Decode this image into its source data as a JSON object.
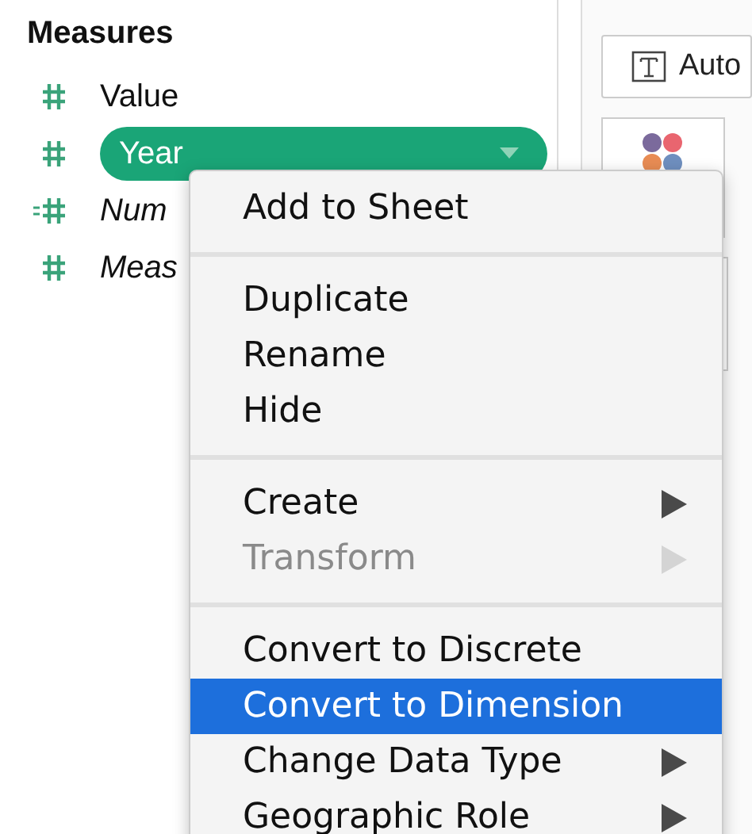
{
  "measures": {
    "title": "Measures",
    "fields": [
      {
        "name": "Value",
        "kind": "plain",
        "italic": false,
        "selected": false
      },
      {
        "name": "Year",
        "kind": "plain",
        "italic": false,
        "selected": true
      },
      {
        "name": "Num",
        "kind": "calculated",
        "italic": true,
        "selected": false
      },
      {
        "name": "Meas",
        "kind": "plain",
        "italic": true,
        "selected": false
      }
    ]
  },
  "marks": {
    "mark_type": "Auto"
  },
  "context_menu": {
    "groups": [
      [
        {
          "label": "Add to Sheet",
          "disabled": false,
          "submenu": false,
          "selected": false
        }
      ],
      [
        {
          "label": "Duplicate",
          "disabled": false,
          "submenu": false,
          "selected": false
        },
        {
          "label": "Rename",
          "disabled": false,
          "submenu": false,
          "selected": false
        },
        {
          "label": "Hide",
          "disabled": false,
          "submenu": false,
          "selected": false
        }
      ],
      [
        {
          "label": "Create",
          "disabled": false,
          "submenu": true,
          "selected": false
        },
        {
          "label": "Transform",
          "disabled": true,
          "submenu": true,
          "selected": false
        }
      ],
      [
        {
          "label": "Convert to Discrete",
          "disabled": false,
          "submenu": false,
          "selected": false
        },
        {
          "label": "Convert to Dimension",
          "disabled": false,
          "submenu": false,
          "selected": true
        },
        {
          "label": "Change Data Type",
          "disabled": false,
          "submenu": true,
          "selected": false
        },
        {
          "label": "Geographic Role",
          "disabled": false,
          "submenu": true,
          "selected": false
        }
      ]
    ]
  }
}
